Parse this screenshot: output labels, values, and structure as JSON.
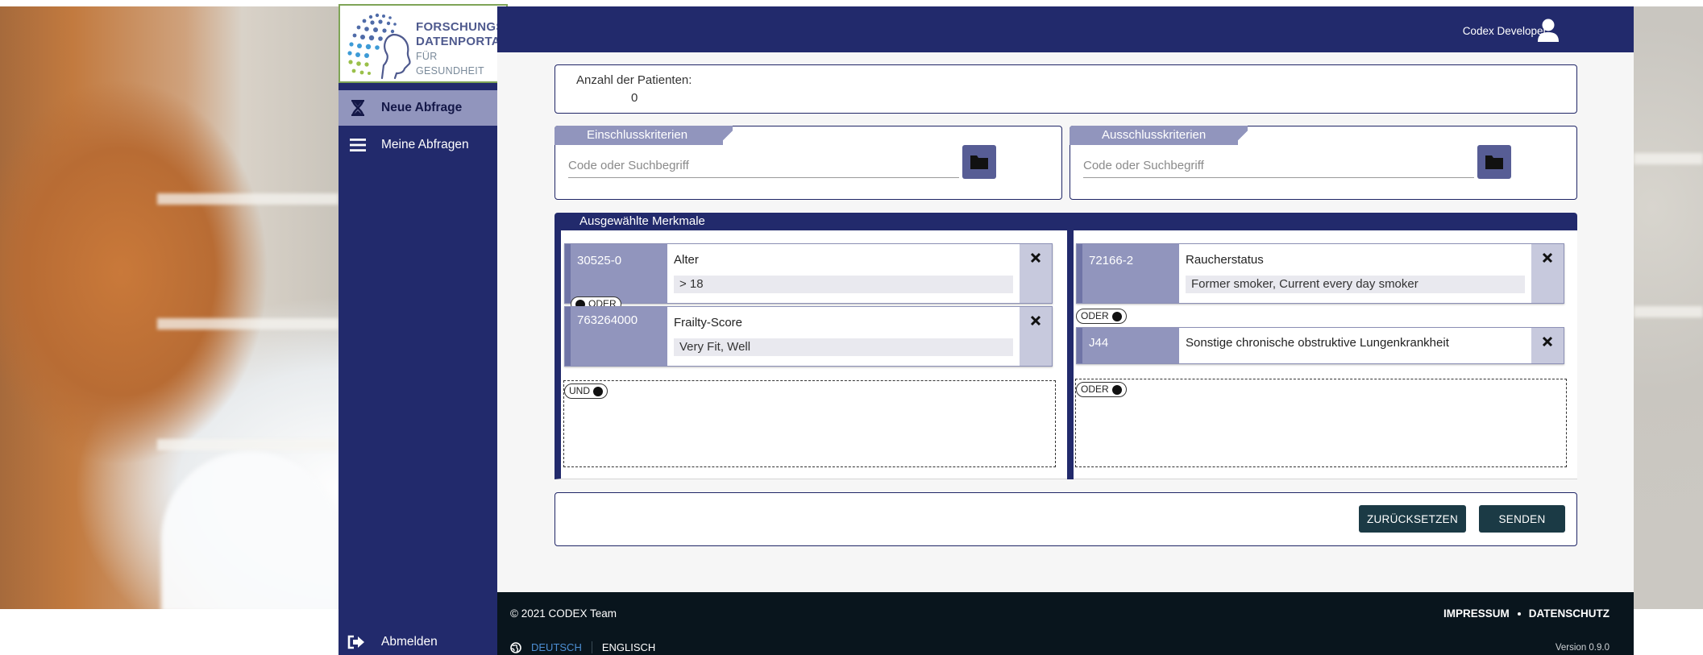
{
  "app": {
    "logo_line1": "FORSCHUNGS-",
    "logo_line2": "DATENPORTAL",
    "logo_line3": "FÜR GESUNDHEIT"
  },
  "header": {
    "user_name": "Codex Developer",
    "user_icon": "user-icon"
  },
  "sidebar": {
    "items": [
      {
        "label": "Neue Abfrage",
        "icon": "hourglass-icon",
        "active": true
      },
      {
        "label": "Meine Abfragen",
        "icon": "menu-icon",
        "active": false
      }
    ],
    "logout_label": "Abmelden",
    "logout_icon": "logout-icon"
  },
  "patients": {
    "label": "Anzahl der Patienten:",
    "value": "0"
  },
  "inclusion": {
    "title": "Einschlusskriterien",
    "placeholder": "Code oder Suchbegriff"
  },
  "exclusion": {
    "title": "Ausschlusskriterien",
    "placeholder": "Code oder Suchbegriff"
  },
  "selected": {
    "title": "Ausgewählte Merkmale",
    "inclusion_features": [
      {
        "code": "30525-0",
        "name": "Alter",
        "value": "> 18"
      },
      {
        "code": "763264000",
        "name": "Frailty-Score",
        "value": "Very Fit, Well"
      }
    ],
    "inclusion_toggle_or": "ODER",
    "inclusion_toggle_and": "UND",
    "exclusion_features": [
      {
        "code": "72166-2",
        "name": "Raucherstatus",
        "value": "Former smoker, Current every day smoker"
      },
      {
        "code": "J44",
        "name": "Sonstige chronische obstruktive Lungenkrankheit",
        "value": ""
      }
    ],
    "exclusion_toggle_or_1": "ODER",
    "exclusion_toggle_or_2": "ODER"
  },
  "actions": {
    "reset_label": "ZURÜCKSETZEN",
    "send_label": "SENDEN"
  },
  "footer": {
    "copyright": "© 2021 CODEX Team",
    "impressum": "IMPRESSUM",
    "datenschutz": "DATENSCHUTZ",
    "lang_de": "DEUTSCH",
    "lang_en": "ENGLISCH",
    "version": "Version 0.9.0"
  }
}
